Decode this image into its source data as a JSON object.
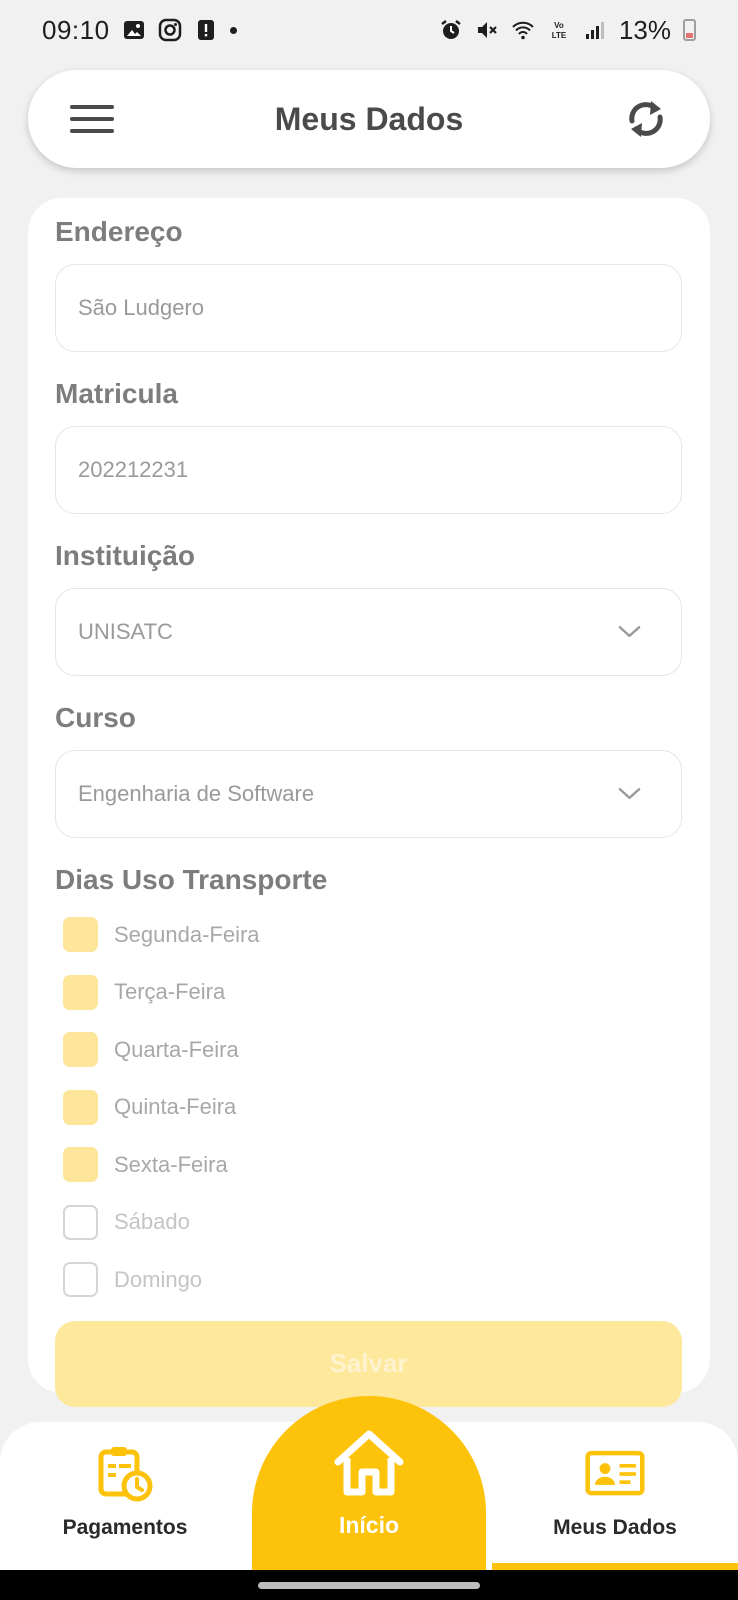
{
  "status_bar": {
    "time": "09:10",
    "battery": "13%",
    "icons_left": [
      "gallery-icon",
      "instagram-icon",
      "alert-icon"
    ],
    "icons_right": [
      "alarm-icon",
      "mute-icon",
      "wifi-icon",
      "volte-icon",
      "signal-icon"
    ]
  },
  "header": {
    "title": "Meus Dados",
    "menu_icon": "hamburger-menu-icon",
    "action_icon": "sync-icon"
  },
  "form": {
    "endereco": {
      "label": "Endereço",
      "value": "São Ludgero"
    },
    "matricula": {
      "label": "Matricula",
      "value": "202212231"
    },
    "instituicao": {
      "label": "Instituição",
      "value": "UNISATC"
    },
    "curso": {
      "label": "Curso",
      "value": "Engenharia de Software"
    },
    "dias": {
      "label": "Dias Uso Transporte",
      "items": [
        {
          "label": "Segunda-Feira",
          "checked": true
        },
        {
          "label": "Terça-Feira",
          "checked": true
        },
        {
          "label": "Quarta-Feira",
          "checked": true
        },
        {
          "label": "Quinta-Feira",
          "checked": true
        },
        {
          "label": "Sexta-Feira",
          "checked": true
        },
        {
          "label": "Sábado",
          "checked": false
        },
        {
          "label": "Domingo",
          "checked": false
        }
      ]
    },
    "save_label": "Salvar"
  },
  "bottom_nav": {
    "pagamentos": "Pagamentos",
    "inicio": "Início",
    "meus_dados": "Meus Dados"
  },
  "colors": {
    "accent": "#fdc20a",
    "checkbox_checked": "#fde599",
    "save_disabled": "#fde89b"
  }
}
